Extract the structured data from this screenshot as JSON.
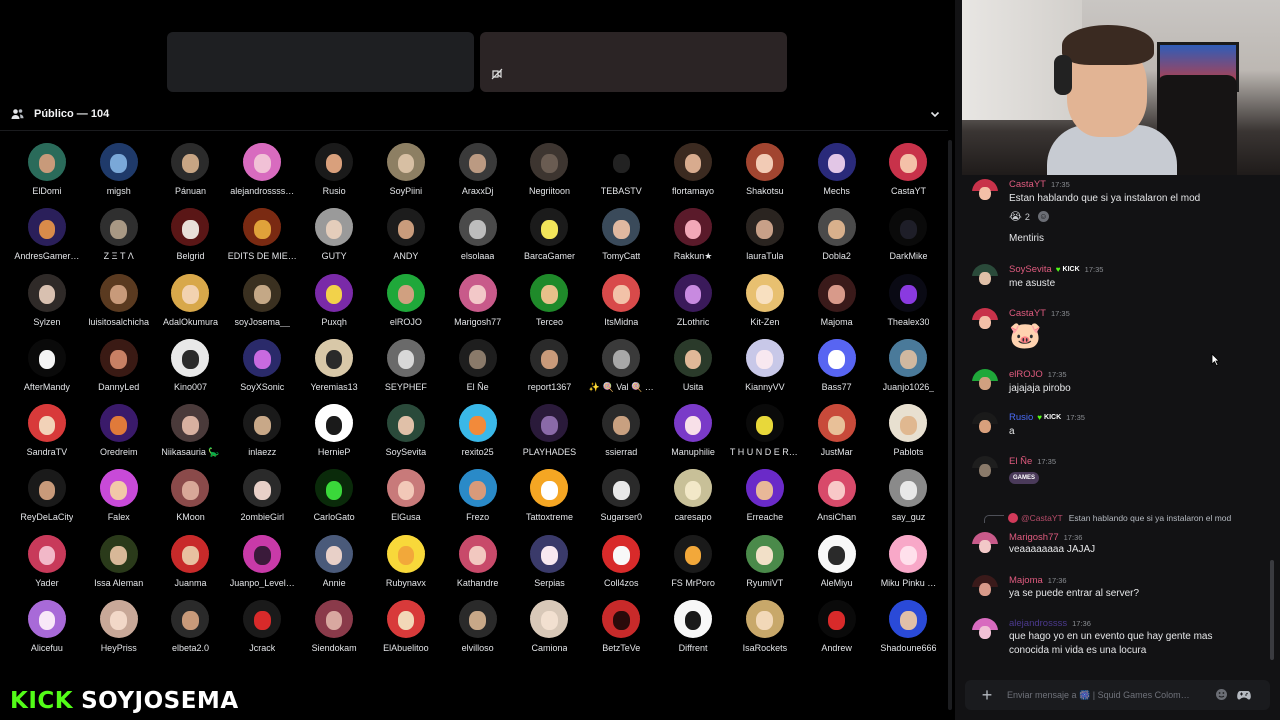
{
  "audience": {
    "title": "Público — 104",
    "members": [
      {
        "name": "ElDomi",
        "c1": "#2a6b5a",
        "c2": "#c89a7a"
      },
      {
        "name": "migsh",
        "c1": "#1f3a6a",
        "c2": "#7aa8d8"
      },
      {
        "name": "Pánuan",
        "c1": "#2b2b2b",
        "c2": "#c7a584"
      },
      {
        "name": "alejandrossss…",
        "c1": "#d86bbf",
        "c2": "#f1c1d6"
      },
      {
        "name": "Rusio",
        "c1": "#1a1a1a",
        "c2": "#d9a07c"
      },
      {
        "name": "SoyPiini",
        "c1": "#8d7f63",
        "c2": "#d7bfa3"
      },
      {
        "name": "AraxxDj",
        "c1": "#3a3a3a",
        "c2": "#bb9a82"
      },
      {
        "name": "Negriitoon",
        "c1": "#3d3530",
        "c2": "#6a5c52"
      },
      {
        "name": "TEBASTV",
        "c1": "#000000",
        "c2": "#222222"
      },
      {
        "name": "flortamayo",
        "c1": "#3b2a20",
        "c2": "#d8ab8e"
      },
      {
        "name": "Shakotsu",
        "c1": "#a24530",
        "c2": "#f2cbb5"
      },
      {
        "name": "Mechs",
        "c1": "#2a2a7a",
        "c2": "#e2c6e6"
      },
      {
        "name": "CastaYT",
        "c1": "#c8324a",
        "c2": "#f4c0a8"
      },
      {
        "name": "AndresGamer…",
        "c1": "#2a1f5a",
        "c2": "#d98b4a"
      },
      {
        "name": "Z Ξ T Λ",
        "c1": "#2f2f2f",
        "c2": "#a89884"
      },
      {
        "name": "Belgrid",
        "c1": "#5a1616",
        "c2": "#e9dfd8"
      },
      {
        "name": "EDITS DE MIE…",
        "c1": "#7a2a12",
        "c2": "#e0a23a"
      },
      {
        "name": "GUTY",
        "c1": "#9a9a9a",
        "c2": "#e4cdbb"
      },
      {
        "name": "ANDY",
        "c1": "#1c1c1c",
        "c2": "#c99c7c"
      },
      {
        "name": "elsolaaa",
        "c1": "#4a4a4a",
        "c2": "#bdbdbd"
      },
      {
        "name": "BarcaGamer",
        "c1": "#1b1b1b",
        "c2": "#f2e55a"
      },
      {
        "name": "TomyCatt",
        "c1": "#3a4a5a",
        "c2": "#e0b8a0"
      },
      {
        "name": "Rakkun★",
        "c1": "#5a1a2a",
        "c2": "#f2a8b8"
      },
      {
        "name": "lauraTula",
        "c1": "#2a2420",
        "c2": "#c8a088"
      },
      {
        "name": "Dobla2",
        "c1": "#4a4a4a",
        "c2": "#d8b08c"
      },
      {
        "name": "DarkMike",
        "c1": "#0a0a0a",
        "c2": "#1e1e28"
      },
      {
        "name": "Sylzen",
        "c1": "#2f2a28",
        "c2": "#d8c0b0"
      },
      {
        "name": "luisitosalchicha",
        "c1": "#5a3a20",
        "c2": "#c89a7a"
      },
      {
        "name": "AdalOkumura",
        "c1": "#d8a84a",
        "c2": "#f2d2b0"
      },
      {
        "name": "soyJosema__",
        "c1": "#3a3020",
        "c2": "#c4a886"
      },
      {
        "name": "Puxqh",
        "c1": "#7a2aa8",
        "c2": "#f2d24a"
      },
      {
        "name": "elROJO",
        "c1": "#1fa83a",
        "c2": "#d0a080"
      },
      {
        "name": "Marigosh77",
        "c1": "#c85a8a",
        "c2": "#f2c8c8"
      },
      {
        "name": "Terceo",
        "c1": "#1f8a2a",
        "c2": "#e8c08a"
      },
      {
        "name": "ItsMidna",
        "c1": "#d84a4a",
        "c2": "#f2c2a8"
      },
      {
        "name": "ZLothric",
        "c1": "#3a1a5a",
        "c2": "#c88ae0"
      },
      {
        "name": "Kit-Zen",
        "c1": "#e8c070",
        "c2": "#f8e0c0"
      },
      {
        "name": "Majoma",
        "c1": "#3a1a1a",
        "c2": "#d89a8a"
      },
      {
        "name": "Thealex30",
        "c1": "#0a0a14",
        "c2": "#8a3ae0"
      },
      {
        "name": "AfterMandy",
        "c1": "#0a0a0a",
        "c2": "#f4f4f4"
      },
      {
        "name": "DannyLed",
        "c1": "#3a1a14",
        "c2": "#c88064"
      },
      {
        "name": "Kino007",
        "c1": "#e8e8e8",
        "c2": "#2a2a2a"
      },
      {
        "name": "SoyXSonic",
        "c1": "#2a2a6a",
        "c2": "#c86ae0"
      },
      {
        "name": "Yeremias13",
        "c1": "#d8c8a8",
        "c2": "#2a2a2a"
      },
      {
        "name": "SEYPHEF",
        "c1": "#6a6a6a",
        "c2": "#d8d8d8"
      },
      {
        "name": "El Ñe",
        "c1": "#1e1e1e",
        "c2": "#8a7a6a"
      },
      {
        "name": "report1367",
        "c1": "#2a2a2a",
        "c2": "#c89a7a"
      },
      {
        "name": "✨ 🍭 Val 🍭 …",
        "c1": "#3a3a3a",
        "c2": "#a8a8a8"
      },
      {
        "name": "Usita",
        "c1": "#2a3a2a",
        "c2": "#e0b898"
      },
      {
        "name": "KiannyVV",
        "c1": "#c8c8e8",
        "c2": "#f8e8f0"
      },
      {
        "name": "Bass77",
        "c1": "#5865f2",
        "c2": "#ffffff"
      },
      {
        "name": "Juanjo1026_",
        "c1": "#4a7a9a",
        "c2": "#d0b8a0"
      },
      {
        "name": "SandraTV",
        "c1": "#d83a3a",
        "c2": "#f2d2b8"
      },
      {
        "name": "Oredreim",
        "c1": "#3a1a6a",
        "c2": "#e07a3a"
      },
      {
        "name": "Niikasauria 🦕",
        "c1": "#4a3a3a",
        "c2": "#d8b0a0"
      },
      {
        "name": "inlaezz",
        "c1": "#1a1a1a",
        "c2": "#c8a888"
      },
      {
        "name": "HernieP",
        "c1": "#ffffff",
        "c2": "#1a1a1a"
      },
      {
        "name": "SoySevita",
        "c1": "#2a4a3a",
        "c2": "#e0c0a8"
      },
      {
        "name": "rexito25",
        "c1": "#3ab8e8",
        "c2": "#f28a3a"
      },
      {
        "name": "PLAYHADES",
        "c1": "#2a1a3a",
        "c2": "#8a6aa8"
      },
      {
        "name": "ssierrad",
        "c1": "#2a2a2a",
        "c2": "#c8a080"
      },
      {
        "name": "Manuphilie",
        "c1": "#7a3ac8",
        "c2": "#f8e0e8"
      },
      {
        "name": "T H U N D E R …",
        "c1": "#0a0a0a",
        "c2": "#e8d83a"
      },
      {
        "name": "JustMar",
        "c1": "#c84a3a",
        "c2": "#e8c098"
      },
      {
        "name": "Pablots",
        "c1": "#e8e0d0",
        "c2": "#e0b890"
      },
      {
        "name": "ReyDeLaCity",
        "c1": "#1a1a1a",
        "c2": "#c89a7a"
      },
      {
        "name": "Falex",
        "c1": "#c84ad8",
        "c2": "#f2c8a8"
      },
      {
        "name": "KMoon",
        "c1": "#8a4a4a",
        "c2": "#d8a898"
      },
      {
        "name": "2ombieGirl",
        "c1": "#2a2a2a",
        "c2": "#e8d0c8"
      },
      {
        "name": "CarloGato",
        "c1": "#0a2a0a",
        "c2": "#3ad83a"
      },
      {
        "name": "ElGusa",
        "c1": "#c87a7a",
        "c2": "#f2c8b8"
      },
      {
        "name": "Frezo",
        "c1": "#2a8ac8",
        "c2": "#d89a7a"
      },
      {
        "name": "Tattoxtreme",
        "c1": "#f5a623",
        "c2": "#ffffff"
      },
      {
        "name": "Sugarser0",
        "c1": "#2a2a2a",
        "c2": "#e8e8e8"
      },
      {
        "name": "caresapo",
        "c1": "#c8c098",
        "c2": "#f2e8c8"
      },
      {
        "name": "Erreache",
        "c1": "#6a2ac8",
        "c2": "#e8b898"
      },
      {
        "name": "AnsiChan",
        "c1": "#d84a6a",
        "c2": "#f8c8c8"
      },
      {
        "name": "say_guz",
        "c1": "#8a8a8a",
        "c2": "#e8e8e8"
      },
      {
        "name": "Yader",
        "c1": "#c83a5a",
        "c2": "#f2b8c8"
      },
      {
        "name": "Issa Aleman",
        "c1": "#2a3a1a",
        "c2": "#d8b898"
      },
      {
        "name": "Juanma",
        "c1": "#c82a2a",
        "c2": "#e8c0a0"
      },
      {
        "name": "Juanpo_Level…",
        "c1": "#c83aa8",
        "c2": "#3a1a3a"
      },
      {
        "name": "Annie",
        "c1": "#4a5a7a",
        "c2": "#e8d0c8"
      },
      {
        "name": "Rubynavx",
        "c1": "#f8d83a",
        "c2": "#f2a83a"
      },
      {
        "name": "Kathandre",
        "c1": "#c84a6a",
        "c2": "#f2c8c0"
      },
      {
        "name": "Serpias",
        "c1": "#3a3a6a",
        "c2": "#f8e8f0"
      },
      {
        "name": "Coll4zos",
        "c1": "#d82a2a",
        "c2": "#f8f8f8"
      },
      {
        "name": "FS MrPoro",
        "c1": "#1a1a1a",
        "c2": "#f2a83a"
      },
      {
        "name": "RyumiVT",
        "c1": "#4a8a4a",
        "c2": "#f2e0c8"
      },
      {
        "name": "AleMiyu",
        "c1": "#f8f8f8",
        "c2": "#2a2a2a"
      },
      {
        "name": "Miku Pinku …",
        "c1": "#f8a8c8",
        "c2": "#ffe0ec"
      },
      {
        "name": "Alicefuu",
        "c1": "#a86ad8",
        "c2": "#f8e8f8"
      },
      {
        "name": "HeyPriss",
        "c1": "#c8a898",
        "c2": "#f2d8c8"
      },
      {
        "name": "elbeta2.0",
        "c1": "#2a2a2a",
        "c2": "#c89a7a"
      },
      {
        "name": "Jcrack",
        "c1": "#1a1a1a",
        "c2": "#d82a2a"
      },
      {
        "name": "Siendokam",
        "c1": "#8a3a4a",
        "c2": "#d8a8a0"
      },
      {
        "name": "ElAbuelitoo",
        "c1": "#d83a3a",
        "c2": "#f2d8b8"
      },
      {
        "name": "elvilloso",
        "c1": "#2a2a2a",
        "c2": "#c8a888"
      },
      {
        "name": "Camiona",
        "c1": "#d8c8b8",
        "c2": "#f2e0d0"
      },
      {
        "name": "BetzTeVe",
        "c1": "#c82a2a",
        "c2": "#2a0a0a"
      },
      {
        "name": "Diffrent",
        "c1": "#f8f8f8",
        "c2": "#1a1a1a"
      },
      {
        "name": "IsaRockets",
        "c1": "#c8a86a",
        "c2": "#f2d8b8"
      },
      {
        "name": "Andrew",
        "c1": "#0a0a0a",
        "c2": "#d82a2a"
      },
      {
        "name": "Shadoune666",
        "c1": "#2a4ad8",
        "c2": "#e0c0a8"
      }
    ]
  },
  "branding": {
    "kick": "KICK",
    "channel": "SOYJOSEMA"
  },
  "chat": {
    "messages": [
      {
        "user": "CastaYT",
        "user_color": "#e05b7f",
        "time": "17:35",
        "text": "Estan hablando que si ya instalaron el mod",
        "avatar": [
          "#c8324a",
          "#f4c0a8"
        ]
      },
      {
        "text": "Mentiris"
      },
      {
        "user": "SoySevita",
        "user_color": "#e05b7f",
        "badge": "KICK",
        "time": "17:35",
        "text": "me asuste",
        "avatar": [
          "#2a4a3a",
          "#e0c0a8"
        ]
      },
      {
        "user": "CastaYT",
        "user_color": "#e05b7f",
        "time": "17:35",
        "avatar": [
          "#c8324a",
          "#f4c0a8"
        ]
      },
      {
        "user": "elROJO",
        "user_color": "#e05b7f",
        "time": "17:35",
        "text": "jajajaja pirobo",
        "avatar": [
          "#1fa83a",
          "#d0a080"
        ]
      },
      {
        "user": "Rusio",
        "user_color": "#4a6cf7",
        "badge": "KICK",
        "time": "17:35",
        "text": "a",
        "avatar": [
          "#1a1a1a",
          "#d9a07c"
        ]
      },
      {
        "user": "El Ñe",
        "user_color": "#e05b7f",
        "time": "17:35",
        "avatar": [
          "#1e1e1e",
          "#8a7a6a"
        ]
      },
      {
        "user": "Marigosh77",
        "user_color": "#e05b7f",
        "time": "17:36",
        "text": "veaaaaaaaa JAJAJ",
        "avatar": [
          "#c85a8a",
          "#f2c8c8"
        ]
      },
      {
        "user": "Majoma",
        "user_color": "#e05b7f",
        "time": "17:36",
        "text": "ya se puede entrar al server?",
        "avatar": [
          "#3a1a1a",
          "#d89a8a"
        ]
      },
      {
        "user": "alejandrossss",
        "user_color": "#7a5af0",
        "time": "17:36",
        "text": "que hago yo en un evento que hay gente mas",
        "text2": "conocida mi vida es una locura",
        "avatar": [
          "#d86bbf",
          "#f1c1d6"
        ]
      }
    ],
    "reaction": {
      "emoji": "😭",
      "count": "2"
    },
    "sticker_emoji": "🐷",
    "gif_label": "GAMES",
    "reply": {
      "user": "@CastaYT",
      "text": "Estan hablando que si ya instalaron el mod"
    },
    "input_placeholder": "Enviar mensaje a 🎆 | Squid Games Colom…"
  },
  "colors": {
    "kick_green": "#53fc18",
    "bg": "#000000",
    "chat_bg": "#121214"
  }
}
